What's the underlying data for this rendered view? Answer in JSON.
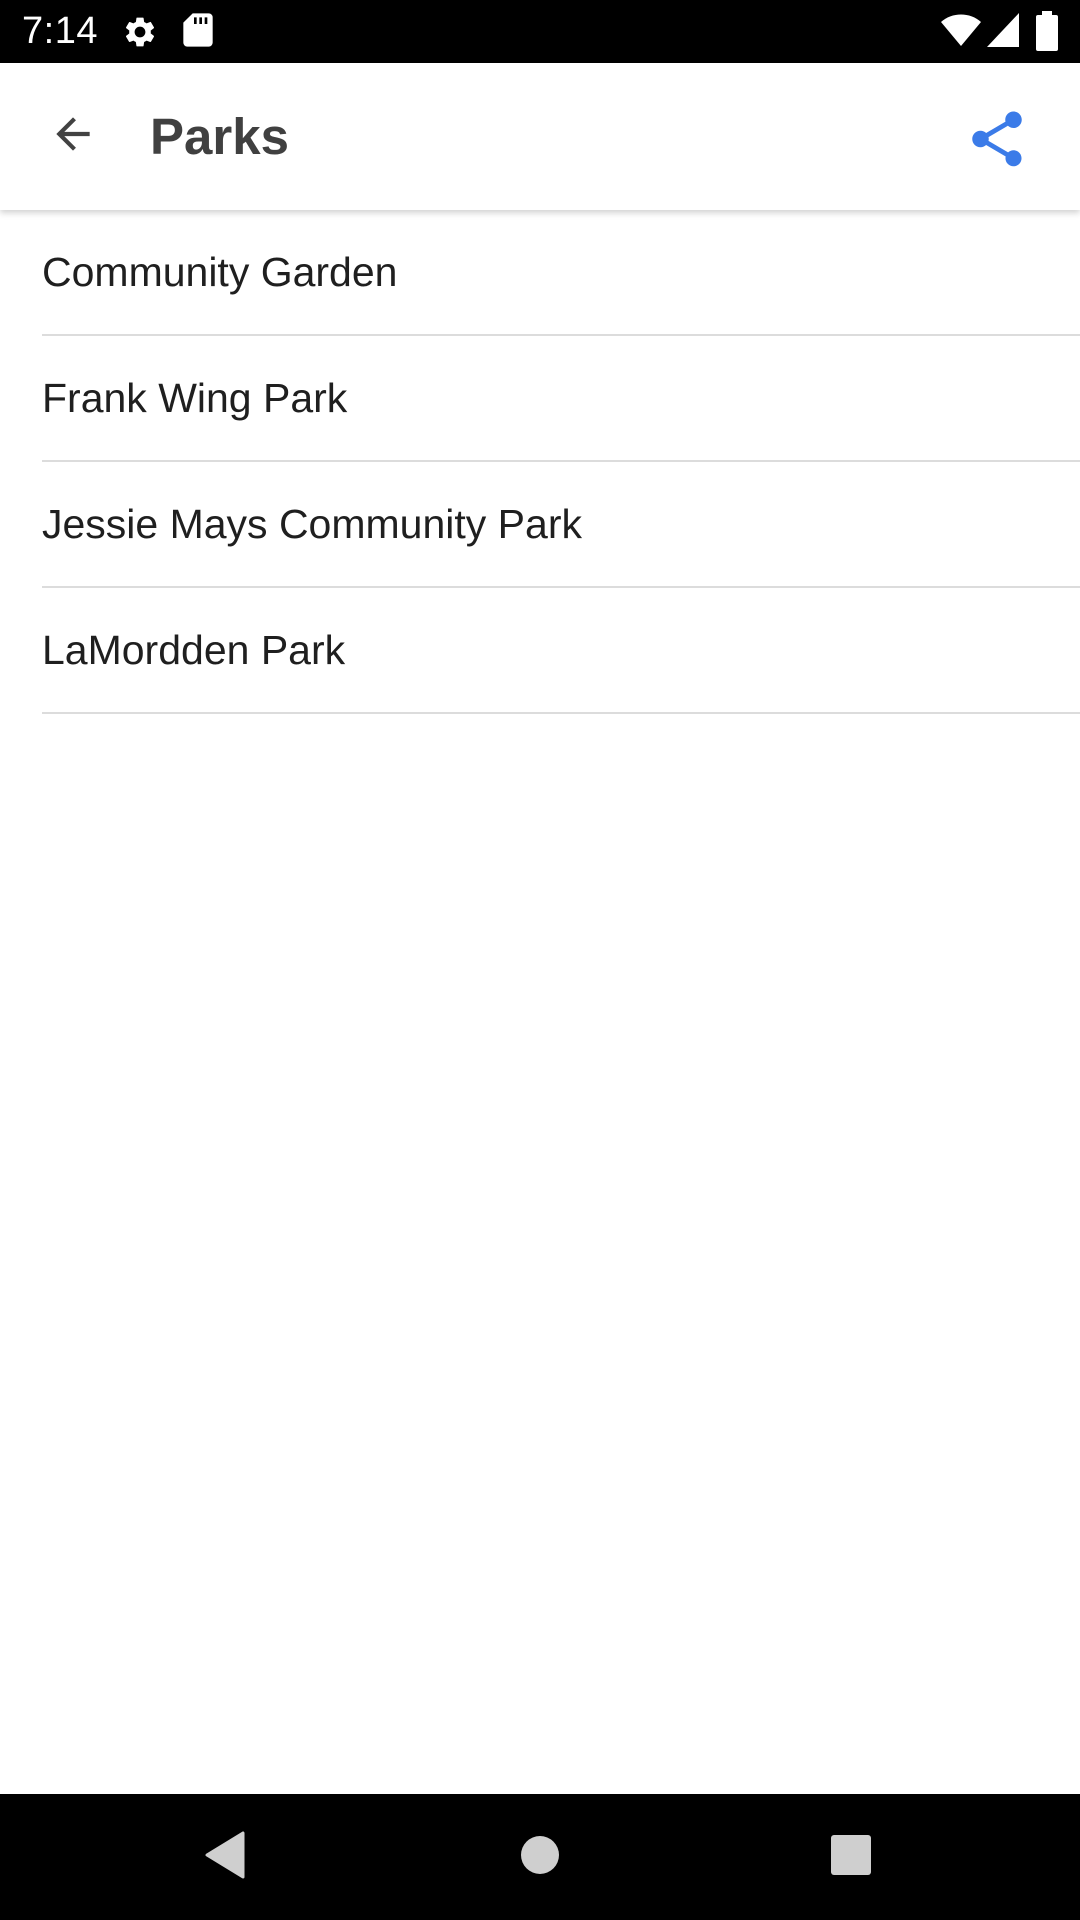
{
  "status_bar": {
    "time": "7:14",
    "icons": [
      "settings-icon",
      "sd-card-icon",
      "wifi-icon",
      "cell-signal-icon",
      "battery-icon"
    ]
  },
  "app_bar": {
    "title": "Parks",
    "back_icon": "arrow-back-icon",
    "share_icon": "share-icon",
    "accent_color": "#3b7be8",
    "title_color": "#404040"
  },
  "parks": {
    "items": [
      {
        "label": "Community Garden"
      },
      {
        "label": "Frank Wing Park"
      },
      {
        "label": "Jessie Mays Community Park"
      },
      {
        "label": "LaMordden Park"
      }
    ]
  },
  "nav_bar": {
    "icons": [
      "back-triangle-icon",
      "home-circle-icon",
      "recents-square-icon"
    ]
  }
}
